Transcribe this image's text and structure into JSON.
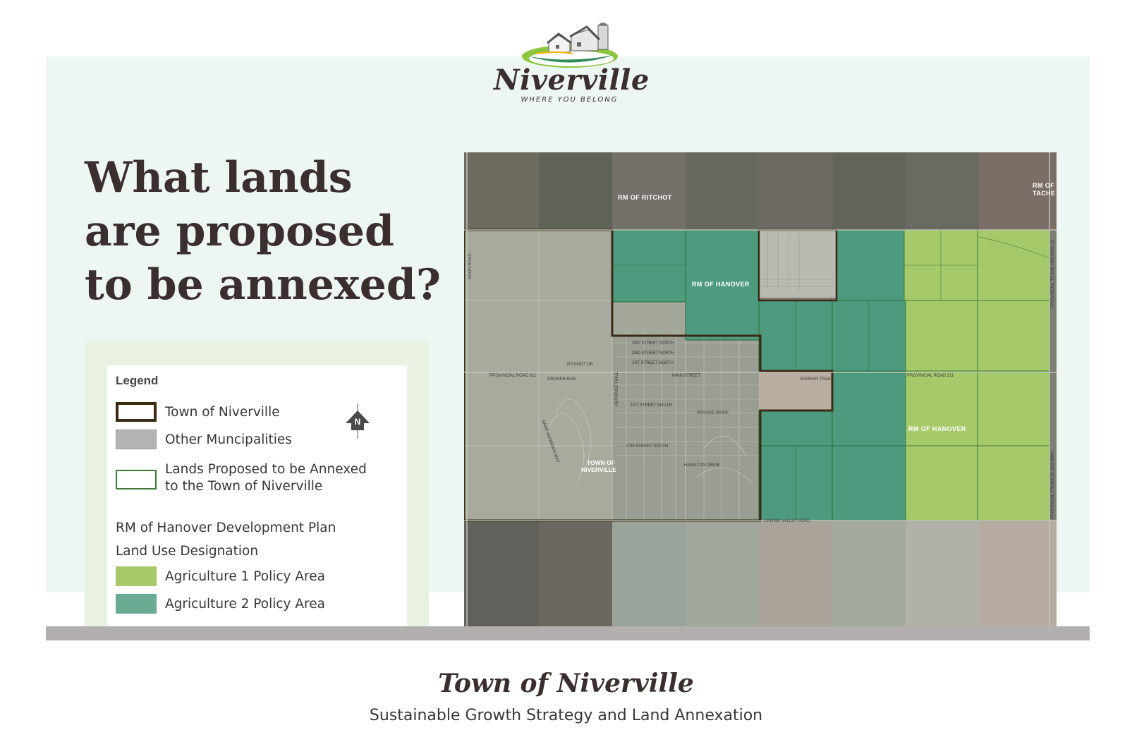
{
  "logo": {
    "name": "Niverville",
    "tagline": "WHERE YOU BELONG"
  },
  "headline": {
    "line1": "What lands",
    "line2": "are proposed",
    "line3": "to be annexed?"
  },
  "legend": {
    "title": "Legend",
    "north_label": "N",
    "items": [
      {
        "label": "Town of Niverville",
        "swatch": "#3b2a16",
        "style": "outline-thick"
      },
      {
        "label": "Other Muncipalities",
        "swatch": "#b3b3b3",
        "style": "fill"
      },
      {
        "label_line1": "Lands Proposed to be Annexed",
        "label_line2": "to the Town of Niverville",
        "swatch": "#3e7a3a",
        "style": "outline-thin"
      }
    ],
    "section_line1": "RM of Hanover Development Plan",
    "section_line2": "Land Use Designation",
    "designations": [
      {
        "label": "Agriculture 1 Policy Area",
        "color": "#a6c96a"
      },
      {
        "label": "Agriculture 2 Policy Area",
        "color": "#6aab93"
      }
    ]
  },
  "map": {
    "labels": {
      "ritchot": "RM OF RITCHOT",
      "tache_1": "RM OF",
      "tache_2": "TACHE",
      "hanover_north": "RM OF HANOVER",
      "hanover_east": "RM OF HANOVER",
      "town_1": "TOWN OF",
      "town_2": "NIVERVILLE"
    },
    "roads": {
      "prov_311_west": "PROVINCIAL ROAD 311",
      "prov_311_east": "PROVINCIAL ROAD 311",
      "drover_run": "DROVER RUN",
      "main_street": "MAIN STREET",
      "snoman_trail": "SNOMAN TRAIL",
      "crown_valley": "CROWN VALLEY ROAD",
      "hamilton_drive": "HAMILTON DRIVE",
      "ritchot_dr": "RITCHOT DR",
      "spruce_drive": "SPRUCE DRIVE",
      "fourth_street": "4TH STREET SOUTH",
      "first_street": "1ST STREET SOUTH",
      "second_street_n": "2ND STREET NORTH",
      "first_street_n": "1ST STREET NORTH",
      "third_street_n": "3RD STREET NORTH",
      "prov_trunk_12": "PROVINCIAL TRUNK HIGHWAY 12",
      "prov_trunk_59": "PROVINCIAL TRUNK 59 HIGHWAY",
      "sood_road": "SOOD ROAD",
      "heritage_trail": "HERITAGE TRAIL",
      "saint_andrews": "SAINT ANDREWS WAY"
    },
    "colors": {
      "town_border": "#3b2a16",
      "agri1": "#a6c96a",
      "agri2": "#4e9a7e",
      "other": "#8c8c8c"
    }
  },
  "footer": {
    "title": "Town of Niverville",
    "subtitle": "Sustainable Growth Strategy and Land Annexation"
  }
}
